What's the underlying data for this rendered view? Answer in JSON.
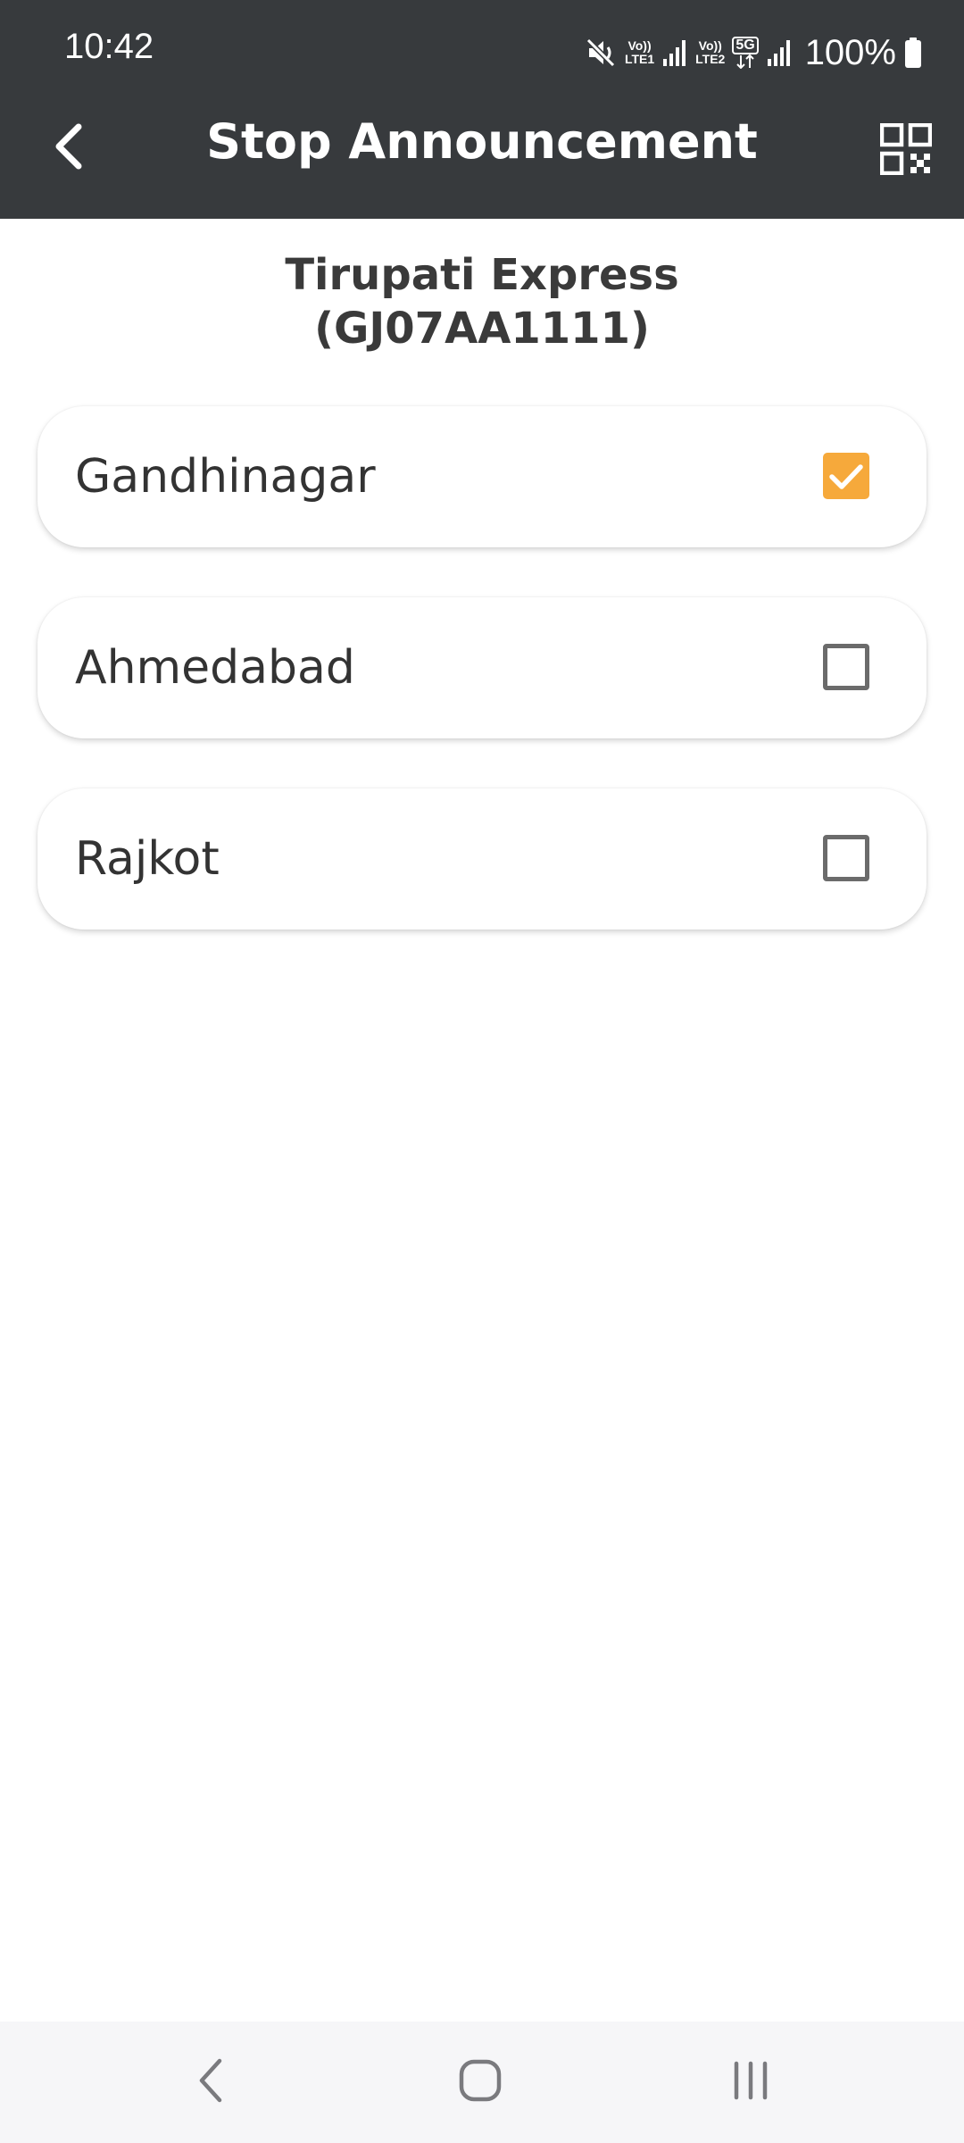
{
  "status_bar": {
    "time": "10:42",
    "sim1_label_top": "Vo))",
    "sim1_label_bottom": "LTE1",
    "sim2_label_top": "Vo))",
    "sim2_label_bottom": "LTE2",
    "network_type": "5G",
    "battery_percent": "100%",
    "icons": [
      "mute-icon",
      "signal-icon",
      "battery-icon"
    ]
  },
  "app_bar": {
    "title": "Stop Announcement",
    "back_icon": "chevron-left-icon",
    "action_icon": "qr-code-icon"
  },
  "bus": {
    "name": "Tirupati Express",
    "registration": "(GJ07AA1111)"
  },
  "stops": [
    {
      "name": "Gandhinagar",
      "checked": true
    },
    {
      "name": "Ahmedabad",
      "checked": false
    },
    {
      "name": "Rajkot",
      "checked": false
    }
  ],
  "colors": {
    "app_bar_bg": "#373a3d",
    "checkbox_checked": "#f6a93b",
    "text_dark": "#333333"
  },
  "nav_bar": {
    "icons": [
      "back-icon",
      "home-icon",
      "recents-icon"
    ]
  }
}
